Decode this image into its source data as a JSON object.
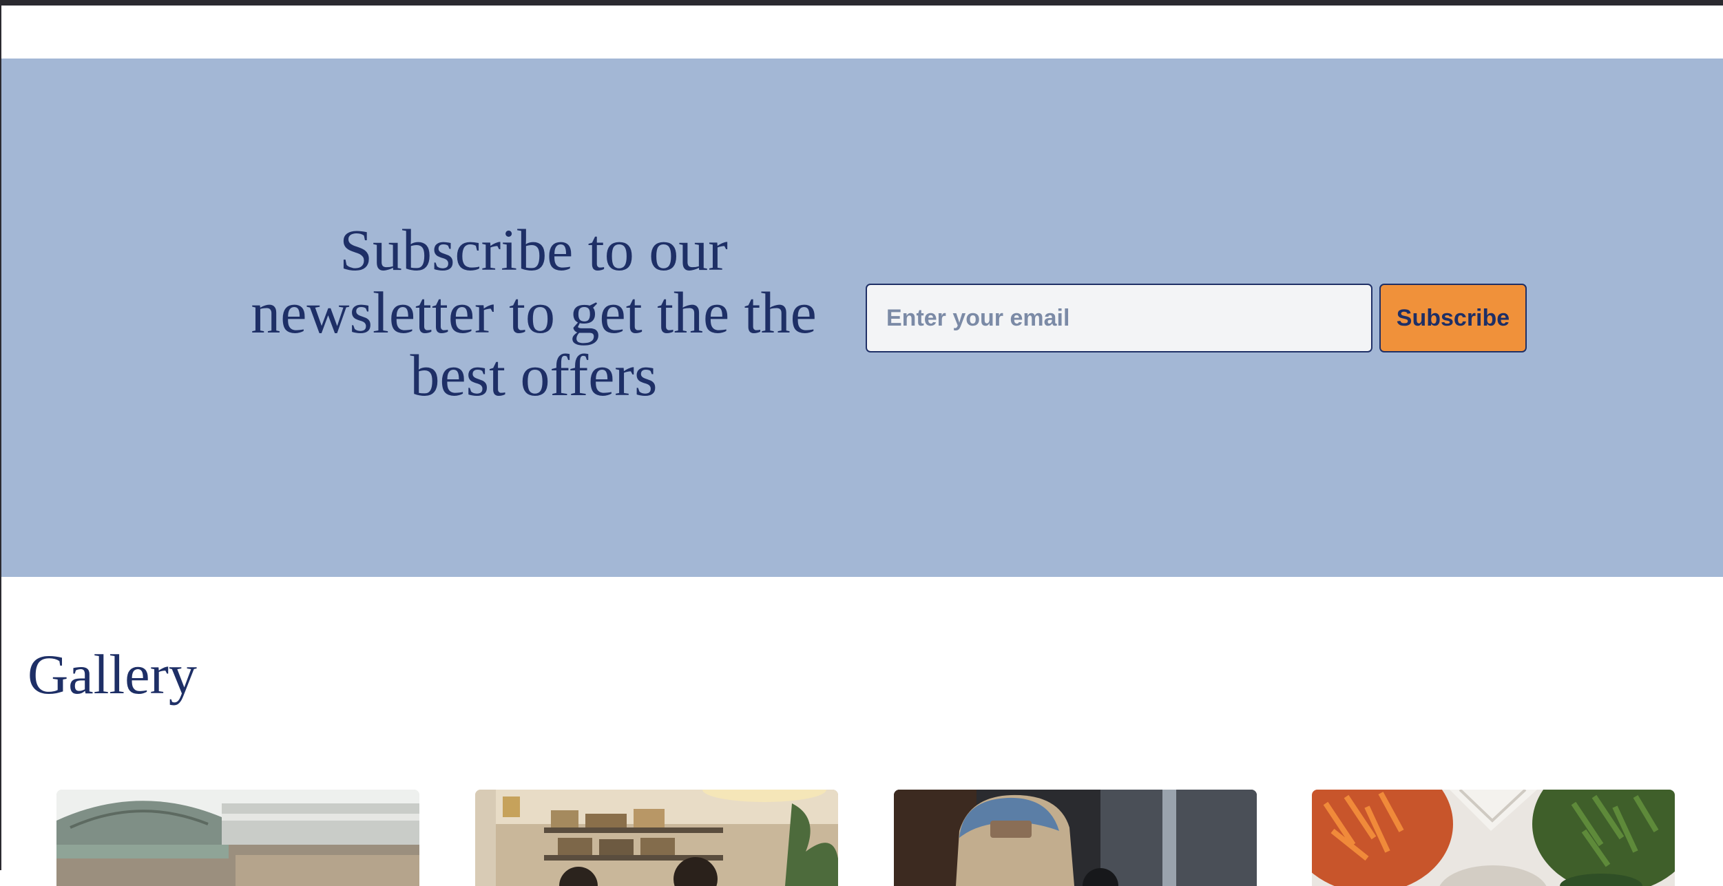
{
  "newsletter": {
    "headline": "Subscribe to our newsletter to get the the best offers",
    "email_placeholder": "Enter your email",
    "subscribe_label": "Subscribe",
    "background_color": "#a3b7d5",
    "button_color": "#f0913a",
    "text_color": "#1e2f66"
  },
  "gallery": {
    "title": "Gallery",
    "images": [
      {
        "subject": "market-stalls-photo"
      },
      {
        "subject": "kitchen-shelves-photo"
      },
      {
        "subject": "person-in-cap-photo"
      },
      {
        "subject": "food-bowls-photo"
      }
    ]
  }
}
